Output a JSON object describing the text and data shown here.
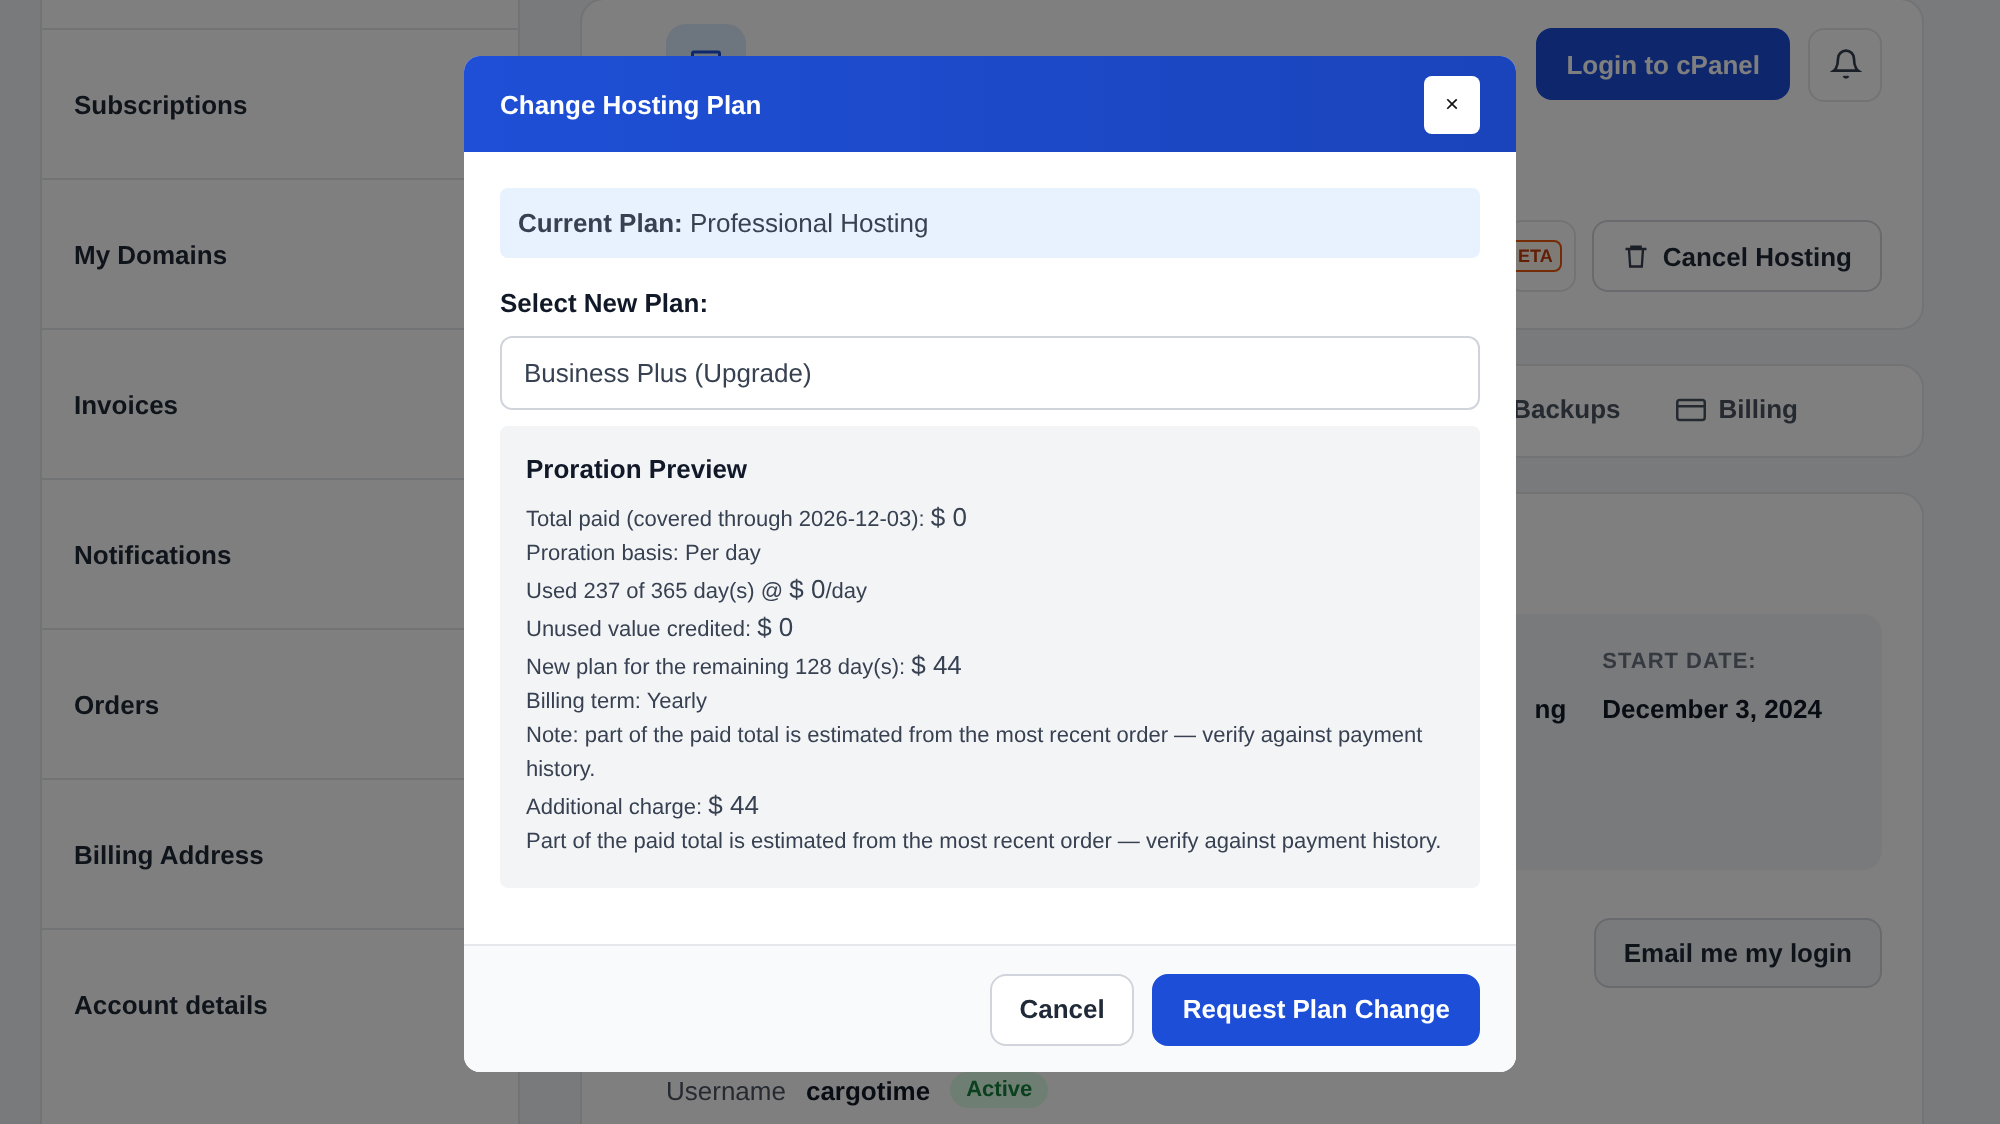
{
  "sidebar": {
    "items": [
      {
        "label": "Subscriptions",
        "selected": false
      },
      {
        "label": "My Domains",
        "selected": false
      },
      {
        "label": "Invoices",
        "selected": false
      },
      {
        "label": "Notifications",
        "selected": false
      },
      {
        "label": "Orders",
        "selected": false
      },
      {
        "label": "Billing Address",
        "selected": false
      },
      {
        "label": "Account details",
        "selected": false
      }
    ]
  },
  "service": {
    "login_button": "Login to cPanel",
    "beta_badge": "ETA",
    "cancel_button": "Cancel Hosting"
  },
  "tabs": [
    {
      "label": "Backups",
      "selected": false,
      "kind": "plain"
    },
    {
      "label": "Billing",
      "selected": false,
      "kind": "with-icon"
    }
  ],
  "details": {
    "cut_value": "ng",
    "start_date_label": "START DATE:",
    "start_date": "December 3, 2024",
    "email_button": "Email me my login",
    "username_label": "Username",
    "username": "cargotime",
    "username_status": "Active"
  },
  "modal": {
    "title": "Change Hosting Plan",
    "close": "×",
    "current_plan_label": "Current Plan:",
    "current_plan": "Professional Hosting",
    "select_label": "Select New Plan:",
    "select_value": "Business Plus (Upgrade)",
    "preview": {
      "title": "Proration Preview",
      "lines": [
        {
          "label": "Total paid (covered through 2026-12-03):",
          "amount": "$ 0"
        },
        {
          "label": "Proration basis: Per day"
        },
        {
          "label": "Used 237 of 365 day(s) @",
          "amount": "$ 0",
          "suffix": "/day"
        },
        {
          "label": "Unused value credited:",
          "amount": "$ 0"
        },
        {
          "label": "New plan for the remaining 128 day(s):",
          "amount": "$ 44"
        },
        {
          "label": "Billing term: Yearly"
        },
        {
          "label": "Note: part of the paid total is estimated from the most recent order — verify against payment history."
        },
        {
          "label": "Additional charge:",
          "amount": "$ 44"
        },
        {
          "label": "Part of the paid total is estimated from the most recent order — verify against payment history."
        }
      ]
    },
    "buttons": [
      {
        "label": "Cancel",
        "kind": "secondary"
      },
      {
        "label": "Request Plan Change",
        "kind": "primary"
      }
    ]
  }
}
